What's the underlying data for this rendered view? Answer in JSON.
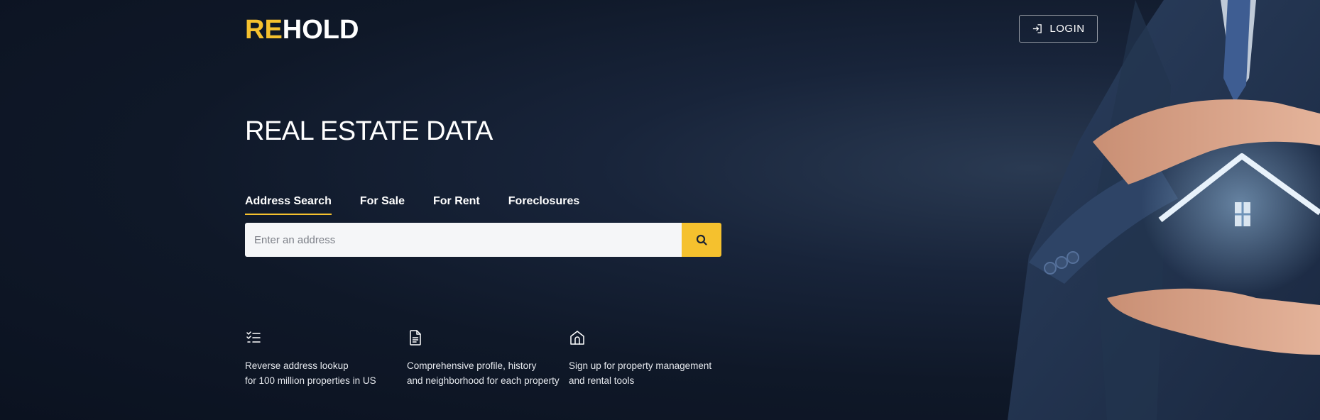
{
  "brand": {
    "logo_prefix": "RE",
    "logo_suffix": "HOLD",
    "accent_color": "#f5c12e"
  },
  "header": {
    "login_label": "LOGIN",
    "login_icon": "login-arrow-icon"
  },
  "hero": {
    "title": "REAL ESTATE DATA"
  },
  "tabs": [
    {
      "label": "Address Search",
      "active": true
    },
    {
      "label": "For Sale",
      "active": false
    },
    {
      "label": "For Rent",
      "active": false
    },
    {
      "label": "Foreclosures",
      "active": false
    }
  ],
  "search": {
    "placeholder": "Enter an address",
    "value": "",
    "button_icon": "search-icon"
  },
  "features": [
    {
      "icon": "checklist-icon",
      "line1": "Reverse address lookup",
      "line2": "for 100 million properties in US"
    },
    {
      "icon": "document-icon",
      "line1": "Comprehensive profile, history",
      "line2": "and neighborhood for each property"
    },
    {
      "icon": "house-icon",
      "line1": "Sign up for property management",
      "line2": "and rental tools"
    }
  ]
}
